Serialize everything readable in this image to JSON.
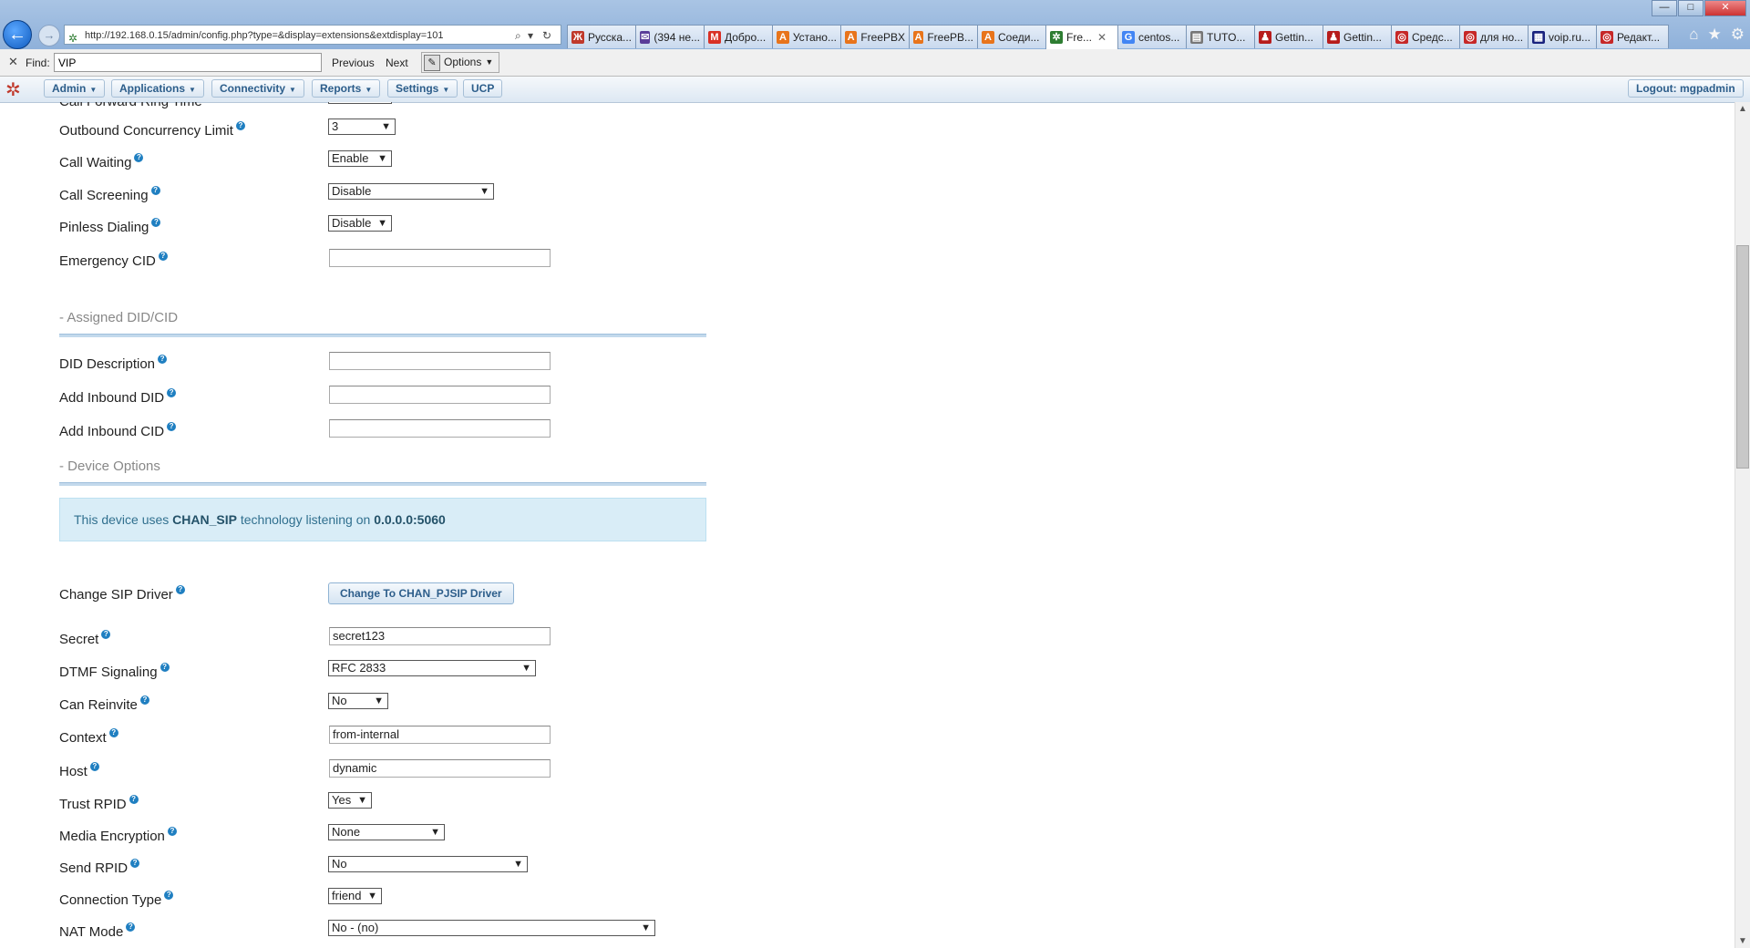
{
  "browser": {
    "address": "http://192.168.0.15/admin/config.php?type=&display=extensions&extdisplay=101",
    "tabs": [
      {
        "label": "Русска...",
        "icon": "zh-icon",
        "color": "#c0392b",
        "glyph": "Ж"
      },
      {
        "label": "(394 не...",
        "icon": "mail-icon",
        "color": "#5b3d99",
        "glyph": "✉"
      },
      {
        "label": "Добро...",
        "icon": "gmail-icon",
        "color": "#d93025",
        "glyph": "M"
      },
      {
        "label": "Устано...",
        "icon": "a-icon",
        "color": "#e8741b",
        "glyph": "A"
      },
      {
        "label": "FreePBX",
        "icon": "a-icon",
        "color": "#e8741b",
        "glyph": "A"
      },
      {
        "label": "FreePB...",
        "icon": "a-icon",
        "color": "#e8741b",
        "glyph": "A"
      },
      {
        "label": "Соеди...",
        "icon": "a-icon",
        "color": "#e8741b",
        "glyph": "A"
      },
      {
        "label": "Fre...",
        "icon": "freepbx-icon",
        "color": "#2e7d32",
        "glyph": "✲",
        "active": true
      },
      {
        "label": "centos...",
        "icon": "google-icon",
        "color": "#4285f4",
        "glyph": "G"
      },
      {
        "label": "TUTO...",
        "icon": "pdf-icon",
        "color": "#777777",
        "glyph": "▤"
      },
      {
        "label": "Gettin...",
        "icon": "people-icon",
        "color": "#b71c1c",
        "glyph": "♟"
      },
      {
        "label": "Gettin...",
        "icon": "people-icon",
        "color": "#b71c1c",
        "glyph": "♟"
      },
      {
        "label": "Средс...",
        "icon": "ring-icon",
        "color": "#c62828",
        "glyph": "◎"
      },
      {
        "label": "для но...",
        "icon": "ring-icon",
        "color": "#c62828",
        "glyph": "◎"
      },
      {
        "label": "voip.ru...",
        "icon": "grid-icon",
        "color": "#1a237e",
        "glyph": "▦"
      },
      {
        "label": "Редакт...",
        "icon": "ring-icon",
        "color": "#c62828",
        "glyph": "◎"
      }
    ],
    "window_controls": {
      "minimize": "—",
      "maximize": "□",
      "close": "✕"
    }
  },
  "findbar": {
    "label": "Find:",
    "value": "VIP",
    "previous": "Previous",
    "next": "Next",
    "options": "Options"
  },
  "nav": {
    "items": [
      {
        "label": "Admin",
        "caret": true
      },
      {
        "label": "Applications",
        "caret": true
      },
      {
        "label": "Connectivity",
        "caret": true
      },
      {
        "label": "Reports",
        "caret": true
      },
      {
        "label": "Settings",
        "caret": true
      },
      {
        "label": "UCP",
        "caret": false
      }
    ],
    "logout": "Logout: mgpadmin"
  },
  "form": {
    "partial_label": "Call Forward Ring Time",
    "outbound_concurrency": {
      "label": "Outbound Concurrency Limit",
      "value": "3"
    },
    "call_waiting": {
      "label": "Call Waiting",
      "value": "Enable"
    },
    "call_screening": {
      "label": "Call Screening",
      "value": "Disable"
    },
    "pinless_dialing": {
      "label": "Pinless Dialing",
      "value": "Disable"
    },
    "emergency_cid": {
      "label": "Emergency CID",
      "value": ""
    },
    "assigned_section": "- Assigned DID/CID",
    "did_description": {
      "label": "DID Description",
      "value": ""
    },
    "inbound_did": {
      "label": "Add Inbound DID",
      "value": ""
    },
    "inbound_cid": {
      "label": "Add Inbound CID",
      "value": ""
    },
    "device_section": "- Device Options",
    "info": {
      "prefix": "This device uses ",
      "tech": "CHAN_SIP",
      "mid": " technology listening on ",
      "addr": "0.0.0.0:5060"
    },
    "change_driver": {
      "label": "Change SIP Driver",
      "button": "Change To CHAN_PJSIP Driver"
    },
    "secret": {
      "label": "Secret",
      "value": "secret123"
    },
    "dtmf": {
      "label": "DTMF Signaling",
      "value": "RFC 2833"
    },
    "can_reinvite": {
      "label": "Can Reinvite",
      "value": "No"
    },
    "context": {
      "label": "Context",
      "value": "from-internal"
    },
    "host": {
      "label": "Host",
      "value": "dynamic"
    },
    "trust_rpid": {
      "label": "Trust RPID",
      "value": "Yes"
    },
    "media_encryption": {
      "label": "Media Encryption",
      "value": "None"
    },
    "send_rpid": {
      "label": "Send RPID",
      "value": "No"
    },
    "connection_type": {
      "label": "Connection Type",
      "value": "friend"
    },
    "nat_mode": {
      "label": "NAT Mode",
      "value": "No - (no)"
    }
  }
}
